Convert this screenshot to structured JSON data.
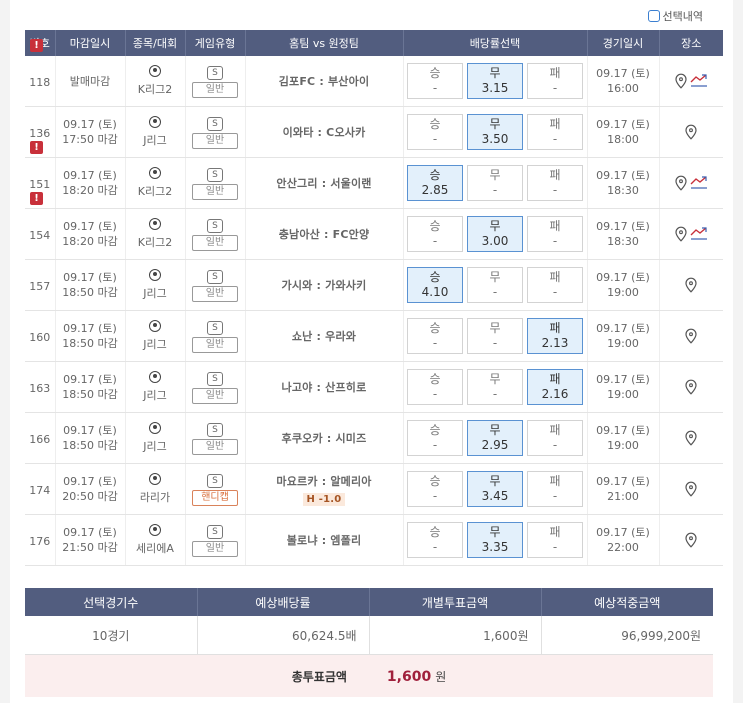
{
  "header": {
    "select_history_label": "선택내역",
    "columns": [
      "번호",
      "마감일시",
      "종목/대회",
      "게임유형",
      "홈팀 vs 원정팀",
      "배당률선택",
      "경기일시",
      "장소"
    ]
  },
  "games": [
    {
      "num": "118",
      "alert": true,
      "deadline1": "발매마감",
      "deadline2": "",
      "league": "K리그2",
      "type_s": "S",
      "type": "일반",
      "handicap": false,
      "teams": "김포FC : 부산아이",
      "hcp": "",
      "win": {
        "label": "승",
        "val": "-"
      },
      "draw": {
        "label": "무",
        "val": "3.15"
      },
      "lose": {
        "label": "패",
        "val": "-"
      },
      "sel": "draw",
      "date1": "09.17 (토)",
      "date2": "16:00",
      "trend": true
    },
    {
      "num": "136",
      "alert": false,
      "deadline1": "09.17 (토)",
      "deadline2": "17:50 마감",
      "league": "J리그",
      "type_s": "S",
      "type": "일반",
      "handicap": false,
      "teams": "이와타 : C오사카",
      "hcp": "",
      "win": {
        "label": "승",
        "val": "-"
      },
      "draw": {
        "label": "무",
        "val": "3.50"
      },
      "lose": {
        "label": "패",
        "val": "-"
      },
      "sel": "draw",
      "date1": "09.17 (토)",
      "date2": "18:00",
      "trend": false
    },
    {
      "num": "151",
      "alert": true,
      "deadline1": "09.17 (토)",
      "deadline2": "18:20 마감",
      "league": "K리그2",
      "type_s": "S",
      "type": "일반",
      "handicap": false,
      "teams": "안산그리 : 서울이랜",
      "hcp": "",
      "win": {
        "label": "승",
        "val": "2.85"
      },
      "draw": {
        "label": "무",
        "val": "-"
      },
      "lose": {
        "label": "패",
        "val": "-"
      },
      "sel": "win",
      "date1": "09.17 (토)",
      "date2": "18:30",
      "trend": true
    },
    {
      "num": "154",
      "alert": true,
      "deadline1": "09.17 (토)",
      "deadline2": "18:20 마감",
      "league": "K리그2",
      "type_s": "S",
      "type": "일반",
      "handicap": false,
      "teams": "충남아산 : FC안양",
      "hcp": "",
      "win": {
        "label": "승",
        "val": "-"
      },
      "draw": {
        "label": "무",
        "val": "3.00"
      },
      "lose": {
        "label": "패",
        "val": "-"
      },
      "sel": "draw",
      "date1": "09.17 (토)",
      "date2": "18:30",
      "trend": true
    },
    {
      "num": "157",
      "alert": false,
      "deadline1": "09.17 (토)",
      "deadline2": "18:50 마감",
      "league": "J리그",
      "type_s": "S",
      "type": "일반",
      "handicap": false,
      "teams": "가시와 : 가와사키",
      "hcp": "",
      "win": {
        "label": "승",
        "val": "4.10"
      },
      "draw": {
        "label": "무",
        "val": "-"
      },
      "lose": {
        "label": "패",
        "val": "-"
      },
      "sel": "win",
      "date1": "09.17 (토)",
      "date2": "19:00",
      "trend": false
    },
    {
      "num": "160",
      "alert": false,
      "deadline1": "09.17 (토)",
      "deadline2": "18:50 마감",
      "league": "J리그",
      "type_s": "S",
      "type": "일반",
      "handicap": false,
      "teams": "쇼난 : 우라와",
      "hcp": "",
      "win": {
        "label": "승",
        "val": "-"
      },
      "draw": {
        "label": "무",
        "val": "-"
      },
      "lose": {
        "label": "패",
        "val": "2.13"
      },
      "sel": "lose",
      "date1": "09.17 (토)",
      "date2": "19:00",
      "trend": false
    },
    {
      "num": "163",
      "alert": false,
      "deadline1": "09.17 (토)",
      "deadline2": "18:50 마감",
      "league": "J리그",
      "type_s": "S",
      "type": "일반",
      "handicap": false,
      "teams": "나고야 : 산프히로",
      "hcp": "",
      "win": {
        "label": "승",
        "val": "-"
      },
      "draw": {
        "label": "무",
        "val": "-"
      },
      "lose": {
        "label": "패",
        "val": "2.16"
      },
      "sel": "lose",
      "date1": "09.17 (토)",
      "date2": "19:00",
      "trend": false
    },
    {
      "num": "166",
      "alert": false,
      "deadline1": "09.17 (토)",
      "deadline2": "18:50 마감",
      "league": "J리그",
      "type_s": "S",
      "type": "일반",
      "handicap": false,
      "teams": "후쿠오카 : 시미즈",
      "hcp": "",
      "win": {
        "label": "승",
        "val": "-"
      },
      "draw": {
        "label": "무",
        "val": "2.95"
      },
      "lose": {
        "label": "패",
        "val": "-"
      },
      "sel": "draw",
      "date1": "09.17 (토)",
      "date2": "19:00",
      "trend": false
    },
    {
      "num": "174",
      "alert": false,
      "deadline1": "09.17 (토)",
      "deadline2": "20:50 마감",
      "league": "라리가",
      "type_s": "S",
      "type": "핸디캡",
      "handicap": true,
      "teams": "마요르카 : 알메리아",
      "hcp": "H -1.0",
      "win": {
        "label": "승",
        "val": "-"
      },
      "draw": {
        "label": "무",
        "val": "3.45"
      },
      "lose": {
        "label": "패",
        "val": "-"
      },
      "sel": "draw",
      "date1": "09.17 (토)",
      "date2": "21:00",
      "trend": false
    },
    {
      "num": "176",
      "alert": false,
      "deadline1": "09.17 (토)",
      "deadline2": "21:50 마감",
      "league": "세리에A",
      "type_s": "S",
      "type": "일반",
      "handicap": false,
      "teams": "볼로냐 : 엠폴리",
      "hcp": "",
      "win": {
        "label": "승",
        "val": "-"
      },
      "draw": {
        "label": "무",
        "val": "3.35"
      },
      "lose": {
        "label": "패",
        "val": "-"
      },
      "sel": "draw",
      "date1": "09.17 (토)",
      "date2": "22:00",
      "trend": false
    }
  ],
  "summary": {
    "columns": [
      "선택경기수",
      "예상배당률",
      "개별투표금액",
      "예상적중금액"
    ],
    "values": [
      "10경기",
      "60,624.5배",
      "1,600원",
      "96,999,200원"
    ],
    "total_label": "총투표금액",
    "total_amount": "1,600",
    "total_unit": "원"
  },
  "colors": {
    "header_bg": "#525d7f",
    "selected_bg": "#e3f0fb",
    "alert": "#c8303a",
    "total_bg": "#fbeeee"
  }
}
